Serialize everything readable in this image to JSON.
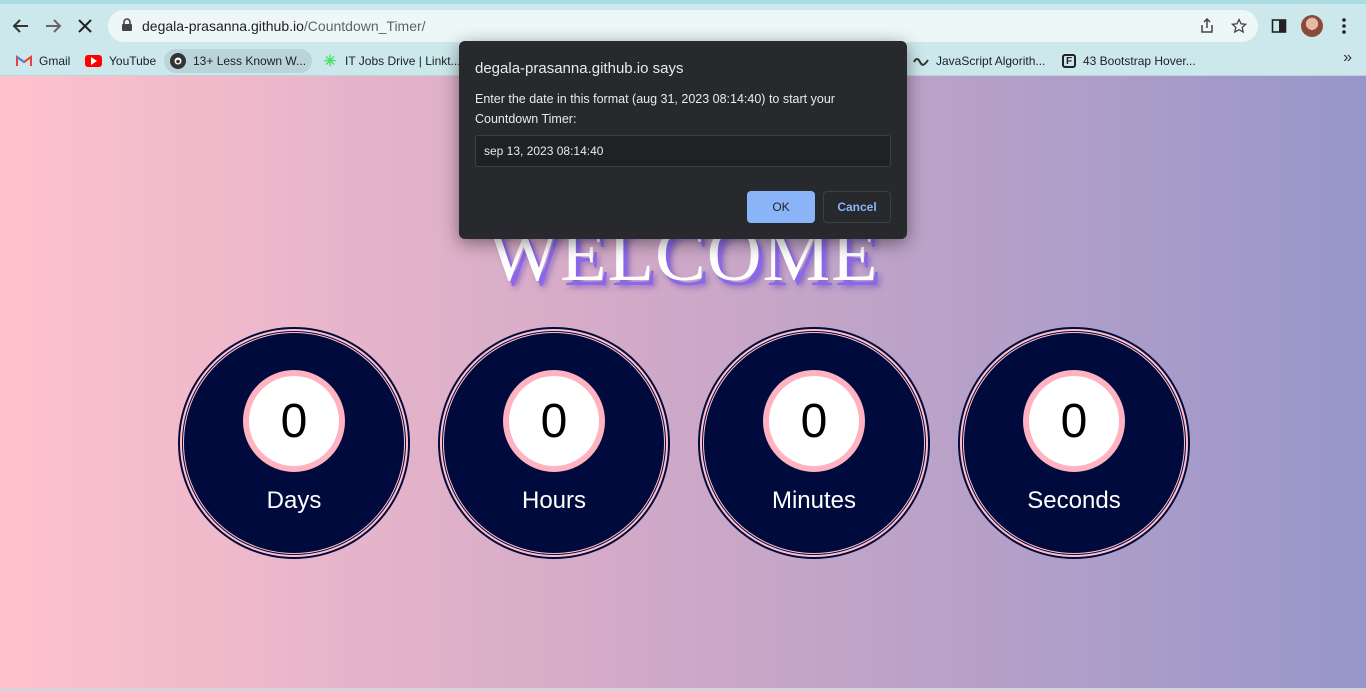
{
  "browser": {
    "url_host": "degala-prasanna.github.io",
    "url_path": "/Countdown_Timer/",
    "icons": [
      "back-arrow-icon",
      "forward-arrow-icon",
      "stop-loading-icon",
      "lock-icon",
      "share-icon",
      "star-icon",
      "sidepanel-icon",
      "profile-avatar",
      "kebab-menu-icon"
    ]
  },
  "bookmarks": [
    {
      "label": "Gmail",
      "icon": "gmail-icon"
    },
    {
      "label": "YouTube",
      "icon": "youtube-icon"
    },
    {
      "label": "13+ Less Known W...",
      "icon": "github-icon"
    },
    {
      "label": "IT Jobs Drive | Linkt...",
      "icon": "linktree-icon"
    },
    {
      "label": "JavaScript Algorith...",
      "icon": "wave-icon"
    },
    {
      "label": "43 Bootstrap Hover...",
      "icon": "f-icon"
    }
  ],
  "page": {
    "heading": "WELCOME",
    "timers": [
      {
        "value": "0",
        "label": "Days"
      },
      {
        "value": "0",
        "label": "Hours"
      },
      {
        "value": "0",
        "label": "Minutes"
      },
      {
        "value": "0",
        "label": "Seconds"
      }
    ]
  },
  "dialog": {
    "title": "degala-prasanna.github.io says",
    "message": "Enter the date in this format (aug 31, 2023 08:14:40) to start your Countdown Timer:",
    "input_value": "sep 13, 2023 08:14:40",
    "ok_label": "OK",
    "cancel_label": "Cancel"
  },
  "colors": {
    "circle_fill": "#000a3c",
    "ring_pink": "#ffb3c0",
    "ok_button": "#8ab4f8",
    "dialog_bg": "#28292c"
  }
}
